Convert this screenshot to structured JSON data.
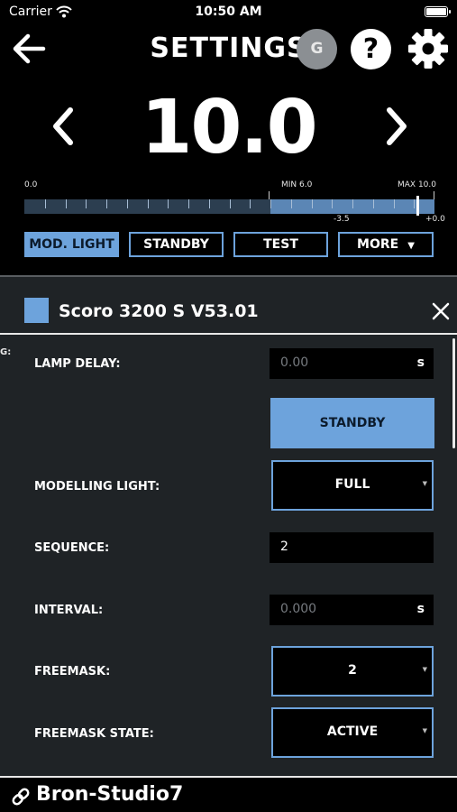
{
  "status_bar": {
    "carrier": "Carrier",
    "time": "10:50 AM"
  },
  "header": {
    "title": "SETTINGS",
    "avatar_letter": "G",
    "help_symbol": "?"
  },
  "power": {
    "value": "10.0",
    "scale": {
      "min_label": "0.0",
      "mid_label": "MIN 6.0",
      "max_label": "MAX 10.0",
      "offset_low": "-3.5",
      "offset_high": "+0.0",
      "range": [
        0,
        10
      ],
      "min": 6.0,
      "max": 10.0,
      "current": 10.0
    }
  },
  "mode_buttons": [
    {
      "label": "MOD. LIGHT",
      "active": true
    },
    {
      "label": "STANDBY",
      "active": false
    },
    {
      "label": "TEST",
      "active": false
    },
    {
      "label": "MORE",
      "active": false
    }
  ],
  "device": {
    "name": "Scoro 3200 S   V53.01",
    "color": "#6da3dc"
  },
  "cut_label": "G:",
  "settings": {
    "lamp_delay": {
      "label": "LAMP DELAY:",
      "value": "0.00",
      "unit": "s"
    },
    "standby_button": "STANDBY",
    "modelling_light": {
      "label": "MODELLING LIGHT:",
      "value": "FULL"
    },
    "sequence": {
      "label": "SEQUENCE:",
      "value": "2"
    },
    "interval": {
      "label": "INTERVAL:",
      "value": "0.000",
      "unit": "s"
    },
    "freemask": {
      "label": "FREEMASK:",
      "value": "2"
    },
    "freemask_state": {
      "label": "FREEMASK STATE:",
      "value": "ACTIVE"
    }
  },
  "footer": {
    "studio": "Bron-Studio7"
  },
  "icons": {
    "back": "arrow-left-icon",
    "help": "question-icon",
    "settings": "gear-icon",
    "prev": "chevron-left-icon",
    "next": "chevron-right-icon",
    "close": "close-icon",
    "link": "link-icon",
    "wifi": "wifi-icon",
    "battery": "battery-icon"
  },
  "colors": {
    "accent": "#6da3dc",
    "background": "#1f2326",
    "bar": "#000000"
  }
}
